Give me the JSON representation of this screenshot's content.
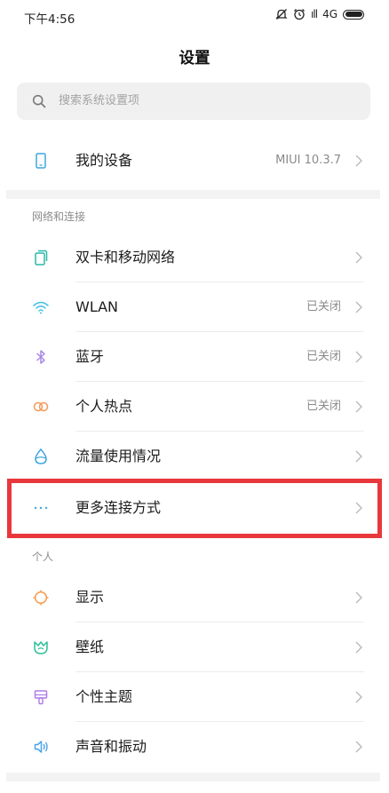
{
  "status_bar": {
    "time": "下午4:56",
    "signal_text": "ıll",
    "network": "4G"
  },
  "header": {
    "title": "设置"
  },
  "search": {
    "placeholder": "搜索系统设置项"
  },
  "device": {
    "label": "我的设备",
    "value": "MIUI 10.3.7"
  },
  "sections": {
    "network": {
      "title": "网络和连接",
      "items": [
        {
          "label": "双卡和移动网络",
          "value": ""
        },
        {
          "label": "WLAN",
          "value": "已关闭"
        },
        {
          "label": "蓝牙",
          "value": "已关闭"
        },
        {
          "label": "个人热点",
          "value": "已关闭"
        },
        {
          "label": "流量使用情况",
          "value": ""
        },
        {
          "label": "更多连接方式",
          "value": ""
        }
      ]
    },
    "personal": {
      "title": "个人",
      "items": [
        {
          "label": "显示"
        },
        {
          "label": "壁纸"
        },
        {
          "label": "个性主题"
        },
        {
          "label": "声音和振动"
        }
      ]
    }
  },
  "colors": {
    "sim_icon": "#2bb8a6",
    "wlan_icon": "#3fc0e5",
    "bluetooth_icon": "#a78ae6",
    "hotspot_icon": "#f29b5a",
    "data_usage_icon": "#3fa6e0",
    "more_icon": "#3fa6e0",
    "display_icon": "#f59a4b",
    "wallpaper_icon": "#2dbf95",
    "theme_icon": "#b07be8",
    "sound_icon": "#4aa3ea",
    "highlight": "#e8383c"
  }
}
